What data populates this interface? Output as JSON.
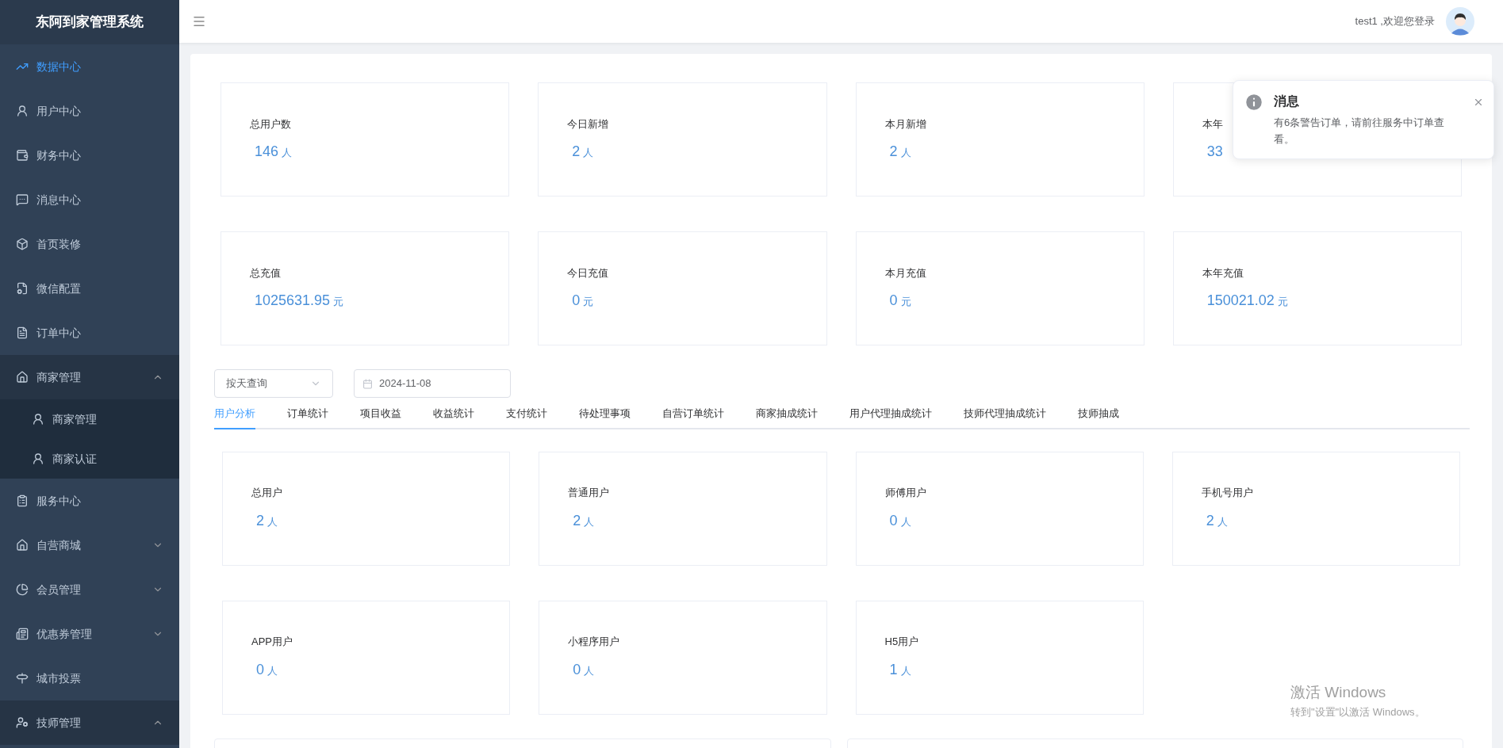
{
  "sidebar": {
    "title": "东阿到家管理系统",
    "items": [
      {
        "label": "数据中心",
        "selected": true
      },
      {
        "label": "用户中心",
        "selected": false
      },
      {
        "label": "财务中心",
        "selected": false
      },
      {
        "label": "消息中心",
        "selected": false
      },
      {
        "label": "首页装修",
        "selected": false
      },
      {
        "label": "微信配置",
        "selected": false
      },
      {
        "label": "订单中心",
        "selected": false
      },
      {
        "label": "商家管理",
        "selected": false,
        "expanded": true,
        "children": [
          {
            "label": "商家管理",
            "selected": false
          },
          {
            "label": "商家认证",
            "selected": false
          }
        ]
      },
      {
        "label": "服务中心",
        "selected": false
      },
      {
        "label": "自营商城",
        "selected": false,
        "expanded": false
      },
      {
        "label": "会员管理",
        "selected": false,
        "expanded": false
      },
      {
        "label": "优惠券管理",
        "selected": false,
        "expanded": false
      },
      {
        "label": "城市投票",
        "selected": false
      },
      {
        "label": "技师管理",
        "selected": false,
        "expanded": true
      }
    ]
  },
  "header": {
    "greeting": "test1 ,欢迎您登录"
  },
  "summary_cards": [
    {
      "label": "总用户数",
      "value": "146",
      "unit": "人"
    },
    {
      "label": "今日新增",
      "value": "2",
      "unit": "人"
    },
    {
      "label": "本月新增",
      "value": "2",
      "unit": "人"
    },
    {
      "label": "本年",
      "value": "33"
    },
    {
      "label": "总充值",
      "value": "1025631.95",
      "unit": "元"
    },
    {
      "label": "今日充值",
      "value": "0",
      "unit": "元"
    },
    {
      "label": "本月充值",
      "value": "0",
      "unit": "元"
    },
    {
      "label": "本年充值",
      "value": "150021.02",
      "unit": "元"
    }
  ],
  "filters": {
    "mode": "按天查询",
    "date": "2024-11-08"
  },
  "tabs": [
    {
      "label": "用户分析",
      "selected": true
    },
    {
      "label": "订单统计",
      "selected": false
    },
    {
      "label": "项目收益",
      "selected": false
    },
    {
      "label": "收益统计",
      "selected": false
    },
    {
      "label": "支付统计",
      "selected": false
    },
    {
      "label": "待处理事项",
      "selected": false
    },
    {
      "label": "自营订单统计",
      "selected": false
    },
    {
      "label": "商家抽成统计",
      "selected": false
    },
    {
      "label": "用户代理抽成统计",
      "selected": false
    },
    {
      "label": "技师代理抽成统计",
      "selected": false
    },
    {
      "label": "技师抽成",
      "selected": false
    }
  ],
  "user_cards": [
    {
      "label": "总用户",
      "value": "2",
      "unit": "人"
    },
    {
      "label": "普通用户",
      "value": "2",
      "unit": "人"
    },
    {
      "label": "师傅用户",
      "value": "0",
      "unit": "人"
    },
    {
      "label": "手机号用户",
      "value": "2",
      "unit": "人"
    },
    {
      "label": "APP用户",
      "value": "0",
      "unit": "人"
    },
    {
      "label": "小程序用户",
      "value": "0",
      "unit": "人"
    },
    {
      "label": "H5用户",
      "value": "1",
      "unit": "人"
    }
  ],
  "notification": {
    "title": "消息",
    "message": "有6条警告订单，请前往服务中订单查看。"
  },
  "os_overlay": {
    "title": "激活 Windows",
    "subtitle": "转到\"设置\"以激活 Windows。"
  }
}
